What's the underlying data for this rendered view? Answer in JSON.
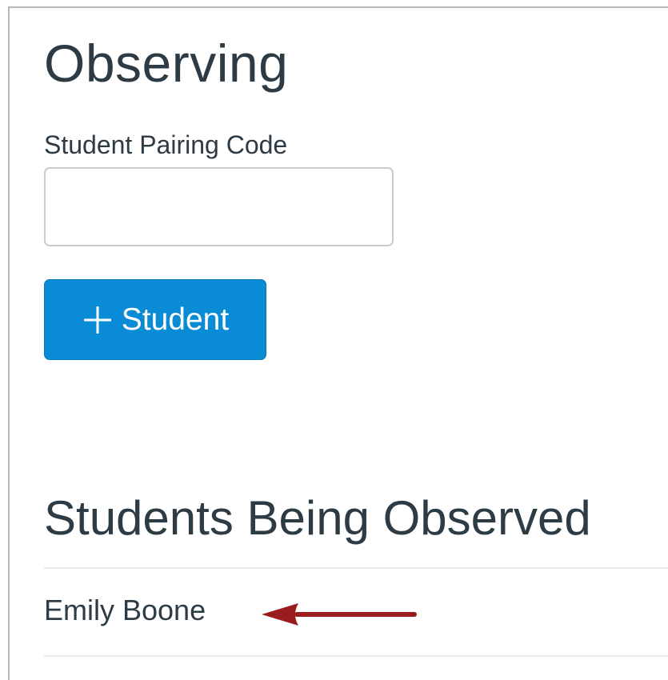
{
  "observing": {
    "title": "Observing",
    "pairing_code_label": "Student Pairing Code",
    "pairing_code_value": "",
    "add_button_label": "Student",
    "add_button_icon": "plus-icon"
  },
  "observed": {
    "title": "Students Being Observed",
    "students": [
      {
        "name": "Emily Boone"
      }
    ],
    "annotation_icon": "arrow-left-icon"
  },
  "colors": {
    "primary_button": "#0a8bd6",
    "text": "#2d3b45",
    "annotation_arrow": "#9b1c1c"
  }
}
